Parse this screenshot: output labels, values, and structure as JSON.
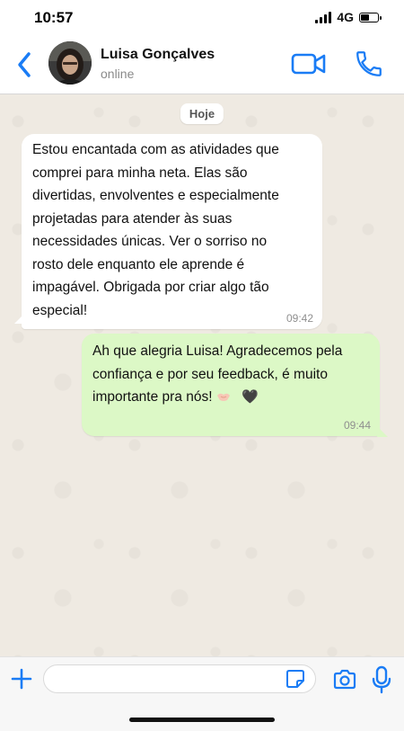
{
  "status_bar": {
    "time": "10:57",
    "network": "4G",
    "battery_level": 0.55
  },
  "header": {
    "contact_name": "Luisa Gonçalves",
    "contact_status": "online"
  },
  "chat": {
    "date_label": "Hoje",
    "messages": [
      {
        "direction": "incoming",
        "lines": [
          "Estou encantada com as atividades que",
          "comprei para minha neta. Elas são",
          "divertidas, envolventes e especialmente",
          "projetadas para atender às suas",
          "necessidades únicas. Ver o sorriso no",
          "rosto dele enquanto ele aprende é",
          "impagável. Obrigada por criar algo tão",
          "especial!"
        ],
        "time": "09:42"
      },
      {
        "direction": "outgoing",
        "lines": [
          "Ah que alegria Luisa! Agradecemos pela",
          "confiança e por seu feedback, é muito",
          "importante pra nós!"
        ],
        "emojis": [
          "handshake",
          "black-heart"
        ],
        "heart": "🖤",
        "time": "09:44"
      }
    ]
  },
  "input": {
    "placeholder": "",
    "value": ""
  },
  "colors": {
    "accent": "#1a7cf5",
    "outgoing_bubble": "#dcf8c6",
    "incoming_bubble": "#ffffff",
    "background": "#efeae2"
  }
}
